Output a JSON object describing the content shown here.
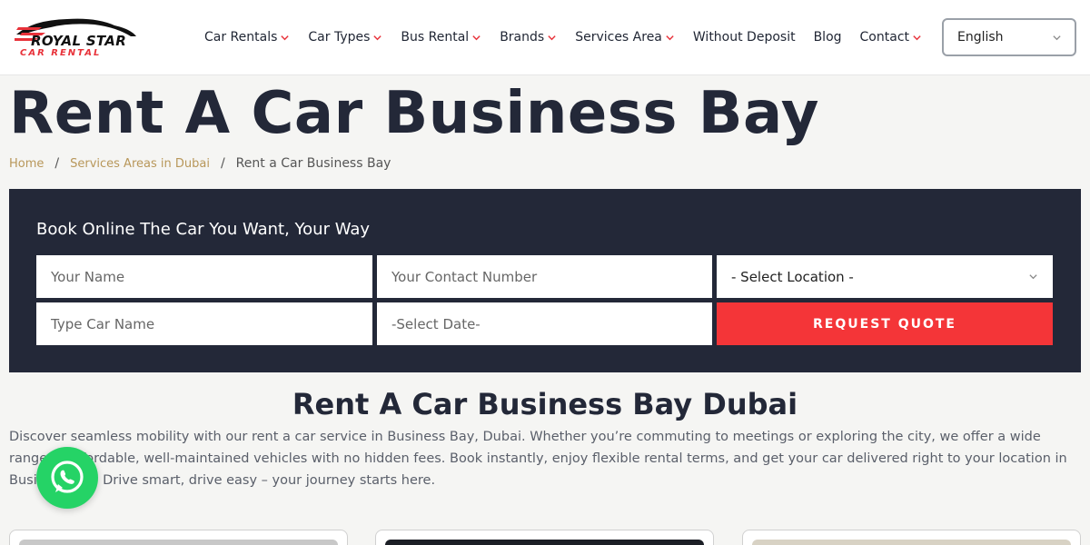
{
  "header": {
    "logo_main": "ROYAL STAR",
    "logo_sub": "CAR RENTAL",
    "nav": [
      {
        "label": "Car Rentals",
        "has_dropdown": true
      },
      {
        "label": "Car Types",
        "has_dropdown": true
      },
      {
        "label": "Bus Rental",
        "has_dropdown": true
      },
      {
        "label": "Brands",
        "has_dropdown": true
      },
      {
        "label": "Services Area",
        "has_dropdown": true
      },
      {
        "label": "Without Deposit",
        "has_dropdown": false
      },
      {
        "label": "Blog",
        "has_dropdown": false
      },
      {
        "label": "Contact",
        "has_dropdown": true
      }
    ],
    "language": "English"
  },
  "page": {
    "title": "Rent A Car Business Bay",
    "breadcrumb": {
      "home": "Home",
      "parent": "Services Areas in Dubai",
      "current": "Rent a Car Business Bay",
      "separator": "/"
    }
  },
  "booking": {
    "title": "Book Online The Car You Want, Your Way",
    "name_placeholder": "Your Name",
    "contact_placeholder": "Your Contact Number",
    "location_value": "- Select Location -",
    "car_placeholder": "Type Car Name",
    "date_placeholder": "-Select Date-",
    "submit_label": "REQUEST QUOTE"
  },
  "intro": {
    "heading": "Rent A Car Business Bay Dubai",
    "text": "Discover seamless mobility with our rent a car service in Business Bay, Dubai. Whether you’re commuting to meetings or exploring the city, we offer a wide range of affordable, well-maintained vehicles with no hidden fees. Book instantly, enjoy flexible rental terms, and get your car delivered right to your location in Business Bay. Drive smart, drive easy – your journey starts here."
  },
  "colors": {
    "accent_red": "#f43538",
    "dark_navy": "#232838",
    "breadcrumb_gold": "#b8975a",
    "whatsapp_green": "#25d366"
  },
  "icons": {
    "dropdown": "chevron-down-icon",
    "whatsapp": "whatsapp-icon"
  }
}
